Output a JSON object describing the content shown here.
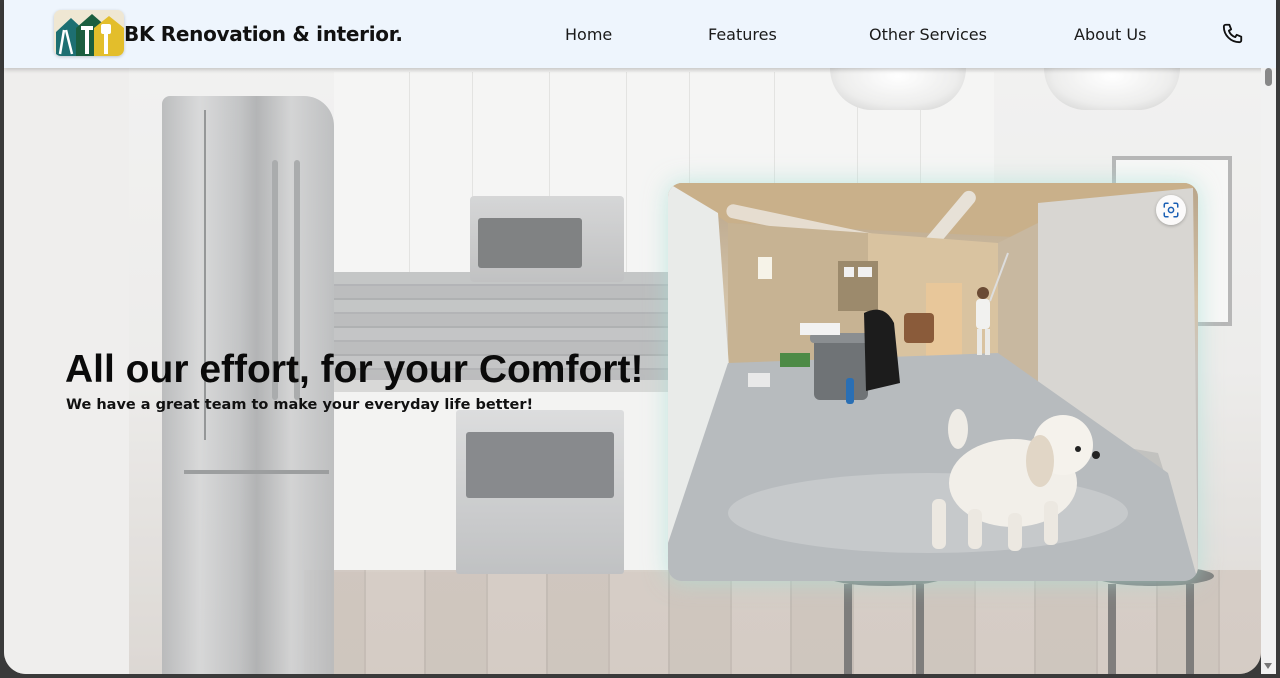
{
  "header": {
    "brand": "BK Renovation & interior.",
    "logo_icon": "house-tools-logo-icon",
    "nav": [
      "Home",
      "Features",
      "Other Services",
      "About Us"
    ],
    "phone_icon": "phone-icon"
  },
  "hero": {
    "title": "All our effort, for your Comfort!",
    "subtitle": "We have a great team to make your everyday life better!",
    "photo_icon": "visual-search-icon"
  },
  "colors": {
    "header_bg": "#eef5fd",
    "text": "#111111",
    "logo_teal": "#1d6f72",
    "logo_yellow": "#e3be2b"
  }
}
